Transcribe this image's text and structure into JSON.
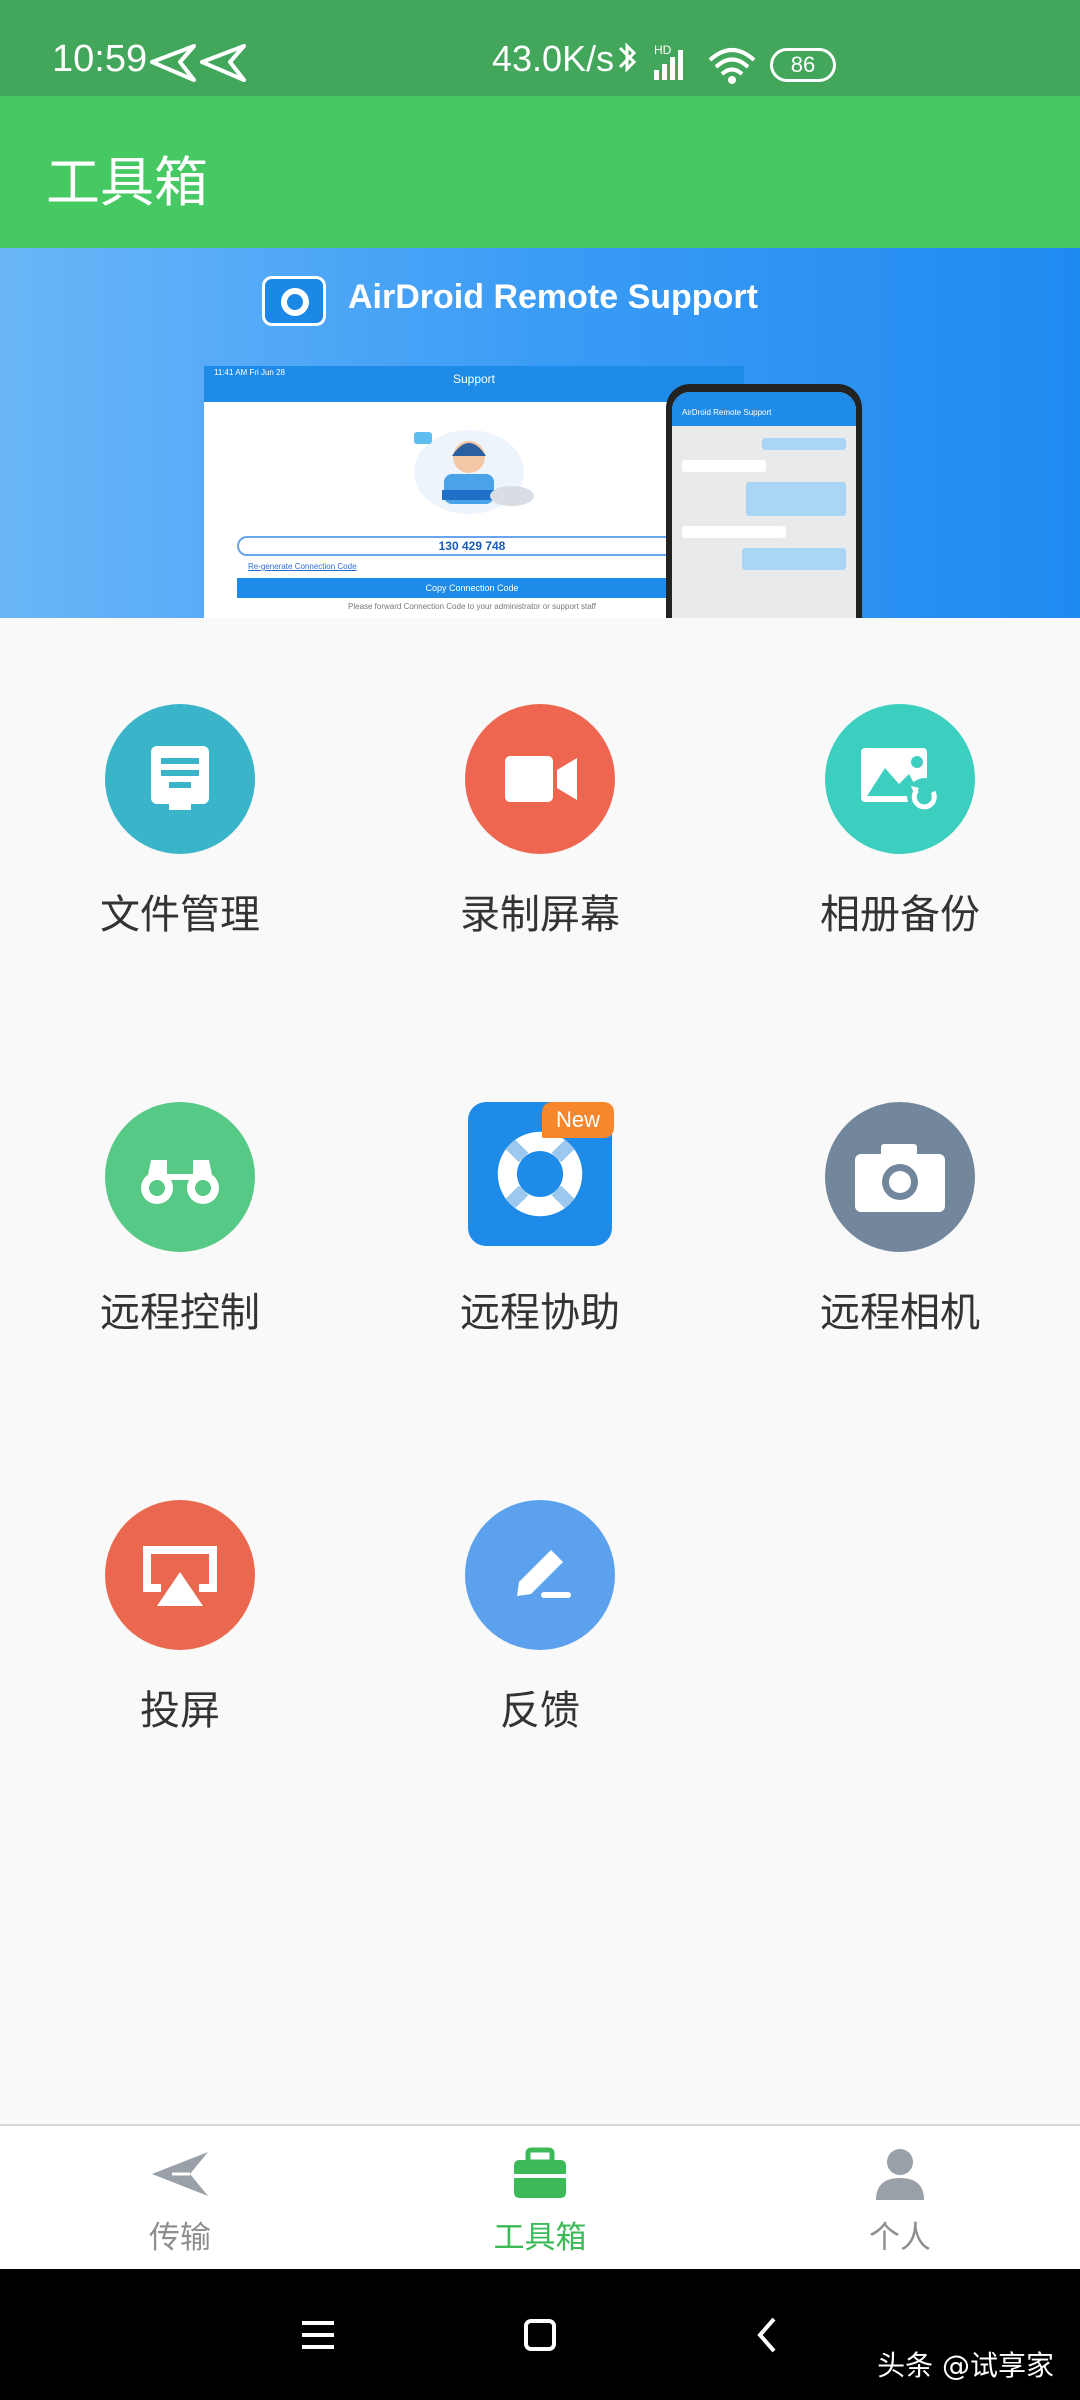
{
  "status_bar": {
    "time": "10:59",
    "net_speed": "43.0K/s",
    "battery": "86"
  },
  "app_bar": {
    "title": "工具箱"
  },
  "banner": {
    "title": "AirDroid Remote Support",
    "tablet_time": "11:41 AM   Fri Jun 28",
    "tablet_header": "Support",
    "connection_code": "130 429 748",
    "regenerate_link": "Re-generate Connection Code",
    "copy_button": "Copy Connection Code",
    "forward_note": "Please forward Connection Code to your administrator or support staff",
    "phone_header": "AirDroid Remote Support"
  },
  "tools": [
    {
      "label": "文件管理",
      "icon": "file-manager-icon",
      "color": "#3ab4c8"
    },
    {
      "label": "录制屏幕",
      "icon": "record-screen-icon",
      "color": "#ee6650"
    },
    {
      "label": "相册备份",
      "icon": "album-backup-icon",
      "color": "#3ccfbf"
    },
    {
      "label": "远程控制",
      "icon": "remote-control-icon",
      "color": "#55c985"
    },
    {
      "label": "远程协助",
      "icon": "remote-assist-icon",
      "color": "#1e8be8",
      "badge": "New"
    },
    {
      "label": "远程相机",
      "icon": "remote-camera-icon",
      "color": "#73879c"
    },
    {
      "label": "投屏",
      "icon": "screen-cast-icon",
      "color": "#ea6850"
    },
    {
      "label": "反馈",
      "icon": "feedback-icon",
      "color": "#5ba1ee"
    }
  ],
  "bottom_nav": {
    "items": [
      {
        "label": "传输",
        "icon": "transfer-icon"
      },
      {
        "label": "工具箱",
        "icon": "toolbox-icon",
        "active": true
      },
      {
        "label": "个人",
        "icon": "profile-icon"
      }
    ]
  },
  "watermark": "头条 @试享家"
}
